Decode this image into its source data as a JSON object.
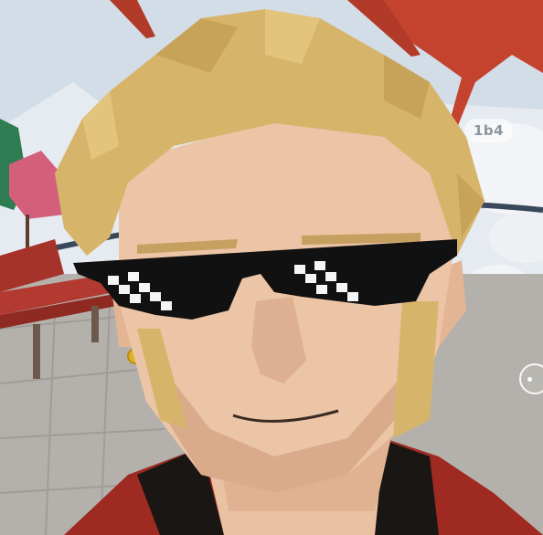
{
  "scene": {
    "player_name_tag": "1b4"
  },
  "colors": {
    "sky": "#d3dde7",
    "snow": "#f1f3f7",
    "tree_red": "#c0402c",
    "bench": "#a63329",
    "ground": "#b3b0ab",
    "skin": "#ecc4a6",
    "hair": "#d6b56b",
    "shades": "#111111",
    "jacket": "#9e2a22"
  },
  "icons": {
    "side_button": "menu-toggle-icon"
  }
}
